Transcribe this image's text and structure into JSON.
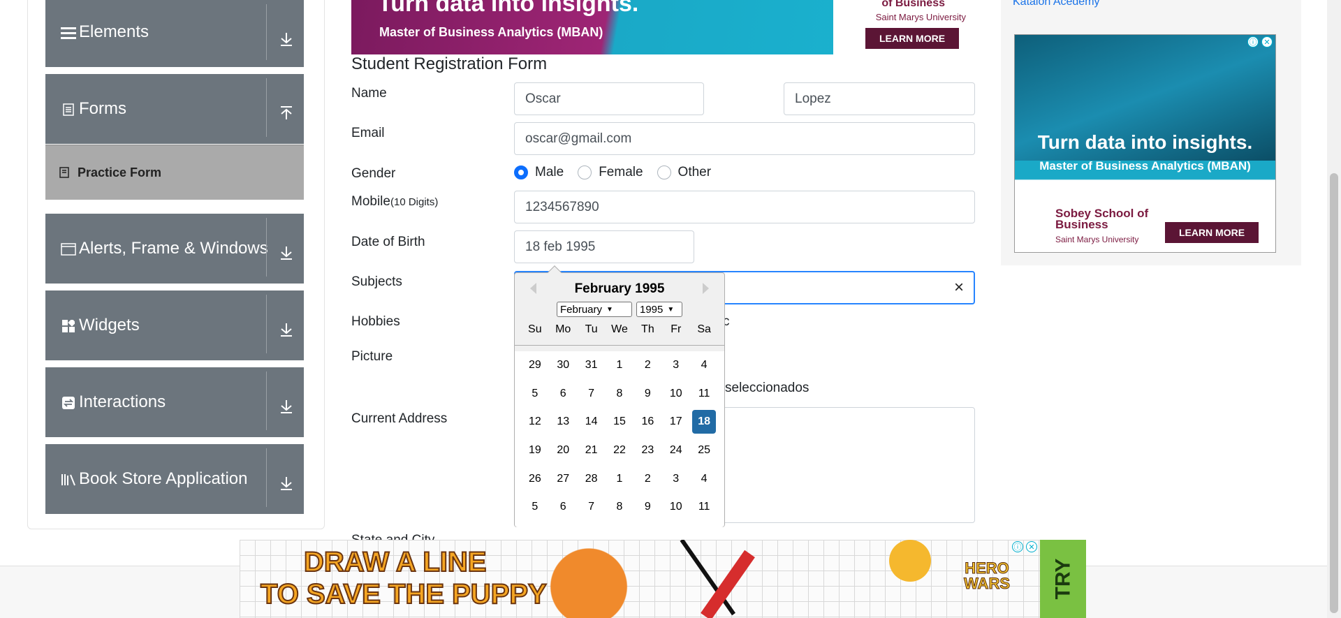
{
  "sidebar": {
    "groups": [
      {
        "label": "Elements",
        "icon": "hamburger-icon",
        "arrow": "down"
      },
      {
        "label": "Forms",
        "icon": "document-icon",
        "arrow": "up"
      },
      {
        "label": "Alerts, Frame & Windows",
        "icon": "window-icon",
        "arrow": "down"
      },
      {
        "label": "Widgets",
        "icon": "widgets-icon",
        "arrow": "down"
      },
      {
        "label": "Interactions",
        "icon": "interactions-icon",
        "arrow": "down"
      },
      {
        "label": "Book Store Application",
        "icon": "books-icon",
        "arrow": "down"
      }
    ],
    "active_item": "Practice Form"
  },
  "banner_top": {
    "headline": "Turn data into insights.",
    "subtitle": "Master of Business Analytics (MBAN)",
    "logo_line1": "of Business",
    "logo_line2": "Saint Marys University",
    "button": "LEARN MORE"
  },
  "form": {
    "title": "Student Registration Form",
    "name_label": "Name",
    "first_name": "Oscar",
    "last_name": "Lopez",
    "email_label": "Email",
    "email": "oscar@gmail.com",
    "gender_label": "Gender",
    "gender_options": [
      "Male",
      "Female",
      "Other"
    ],
    "gender_selected": "Male",
    "mobile_label": "Mobile",
    "mobile_hint": "(10 Digits)",
    "mobile": "1234567890",
    "dob_label": "Date of Birth",
    "dob": "18 feb 1995",
    "subjects_label": "Subjects",
    "subjects_clear": "×",
    "hobbies_label": "Hobbies",
    "hobbies_peek": "c",
    "picture_label": "Picture",
    "picture_peek": "seleccionados",
    "address_label": "Current Address",
    "state_label": "State and City"
  },
  "datepicker": {
    "month_title": "February 1995",
    "month_select": "February",
    "year_select": "1995",
    "weekdays": [
      "Su",
      "Mo",
      "Tu",
      "We",
      "Th",
      "Fr",
      "Sa"
    ],
    "weeks": [
      [
        "29",
        "30",
        "31",
        "1",
        "2",
        "3",
        "4"
      ],
      [
        "5",
        "6",
        "7",
        "8",
        "9",
        "10",
        "11"
      ],
      [
        "12",
        "13",
        "14",
        "15",
        "16",
        "17",
        "18"
      ],
      [
        "19",
        "20",
        "21",
        "22",
        "23",
        "24",
        "25"
      ],
      [
        "26",
        "27",
        "28",
        "1",
        "2",
        "3",
        "4"
      ],
      [
        "5",
        "6",
        "7",
        "8",
        "9",
        "10",
        "11"
      ]
    ],
    "selected_day": "18",
    "selected_color": "#216ba5"
  },
  "right_ad": {
    "link_text": "Katalon Acedemy",
    "headline": "Turn data into insights.",
    "subtitle": "Master of Business Analytics (MBAN)",
    "logo_line1": "Sobey School of Business",
    "logo_line2": "Saint Marys University",
    "button": "LEARN MORE"
  },
  "bottom_ad": {
    "line1": "DRAW A LINE",
    "line2": "TO SAVE THE PUPPY",
    "logo": "HERO WARS",
    "cta": "TRY"
  },
  "ad_controls": {
    "info": "ⓘ",
    "close": "✕"
  }
}
